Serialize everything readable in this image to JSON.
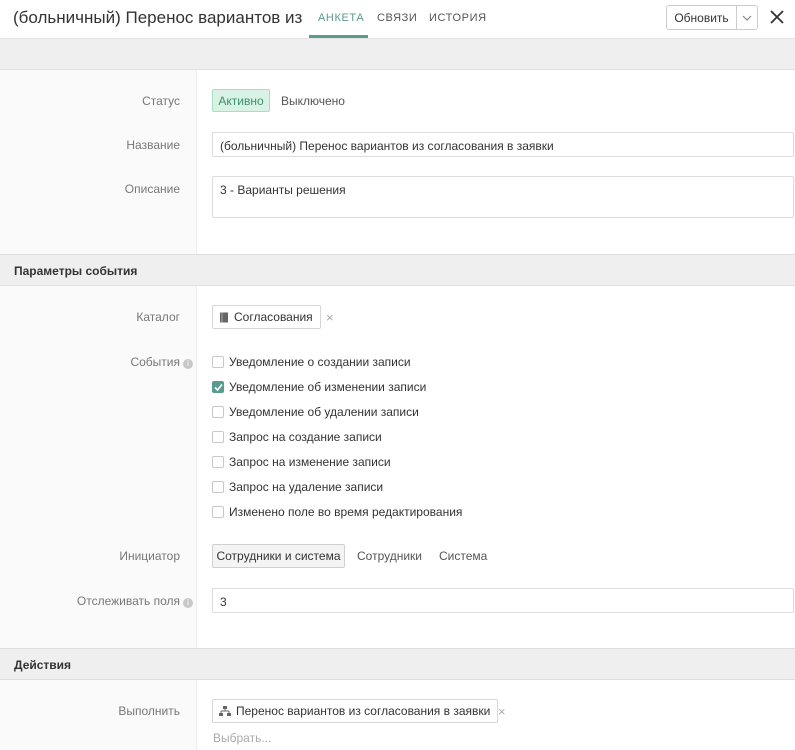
{
  "header": {
    "title": "(больничный) Перенос вариантов из",
    "tabs": [
      {
        "label": "АНКЕТА",
        "active": true
      },
      {
        "label": "СВЯЗИ",
        "active": false
      },
      {
        "label": "ИСТОРИЯ",
        "active": false
      }
    ],
    "update_label": "Обновить",
    "accent_color": "#5b9a8f"
  },
  "main": {
    "status": {
      "label": "Статус",
      "options": [
        "Активно",
        "Выключено"
      ],
      "selected": "Активно"
    },
    "name": {
      "label": "Название",
      "value": "(больничный) Перенос вариантов из согласования в заявки"
    },
    "description": {
      "label": "Описание",
      "value": "3 - Варианты решения"
    }
  },
  "event_params": {
    "title": "Параметры события",
    "catalog": {
      "label": "Каталог",
      "value": "Согласования",
      "icon": "book-icon"
    },
    "events": {
      "label": "События",
      "items": [
        {
          "label": "Уведомление о создании записи",
          "checked": false
        },
        {
          "label": "Уведомление об изменении записи",
          "checked": true
        },
        {
          "label": "Уведомление об удалении записи",
          "checked": false
        },
        {
          "label": "Запрос на создание записи",
          "checked": false
        },
        {
          "label": "Запрос на изменение записи",
          "checked": false
        },
        {
          "label": "Запрос на удаление записи",
          "checked": false
        },
        {
          "label": "Изменено поле во время редактирования",
          "checked": false
        }
      ]
    },
    "initiator": {
      "label": "Инициатор",
      "options": [
        "Сотрудники и система",
        "Сотрудники",
        "Система"
      ],
      "selected": "Сотрудники и система"
    },
    "track_fields": {
      "label": "Отслеживать поля",
      "value": "3"
    }
  },
  "actions": {
    "title": "Действия",
    "execute": {
      "label": "Выполнить",
      "value": "Перенос вариантов из согласования в заявки",
      "icon": "hierarchy-icon",
      "choose_placeholder": "Выбрать..."
    }
  }
}
